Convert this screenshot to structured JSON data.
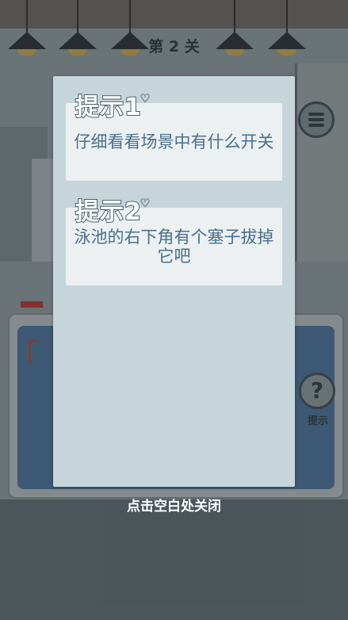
{
  "level": {
    "title": "第 2 关"
  },
  "menu_button": {
    "icon": "menu-icon"
  },
  "hint_button": {
    "icon": "question-bulb-icon",
    "label": "提示"
  },
  "hints_panel": {
    "hints": [
      {
        "title": "提示1",
        "text": "仔细看看场景中有什么开关"
      },
      {
        "title": "提示2",
        "text": "泳池的右下角有个塞子拔掉它吧"
      }
    ]
  },
  "close_tip": "点击空白处关闭",
  "colors": {
    "panel": "#c6d5da",
    "hint_box": "#ecf0f1",
    "hint_text": "#4a6f8e",
    "hint_title_outline": "#4a5f74",
    "pool_water": "#4b6f95"
  }
}
